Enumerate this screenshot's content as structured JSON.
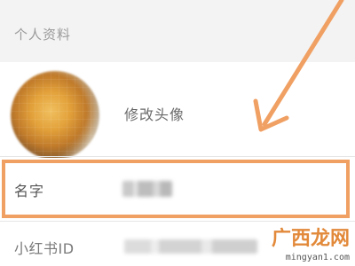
{
  "section": {
    "title": "个人资料"
  },
  "avatar_row": {
    "label": "修改头像"
  },
  "name_row": {
    "label": "名字"
  },
  "id_row": {
    "label": "小红书ID"
  },
  "watermark": {
    "site_cn": "广西龙网",
    "site_url": "mingyan1.com"
  },
  "colors": {
    "highlight": "#f0a063",
    "header_bg": "#f3f3f3"
  },
  "icons": {
    "annotation_arrow": "arrow-down-left-icon"
  }
}
